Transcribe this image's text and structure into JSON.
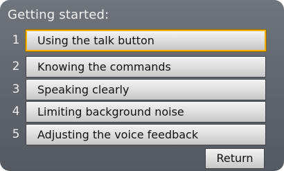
{
  "screen": {
    "title": "Getting started:"
  },
  "menu": {
    "items": [
      {
        "number": "1",
        "label": "Using the talk button",
        "selected": true
      },
      {
        "number": "2",
        "label": "Knowing the commands",
        "selected": false
      },
      {
        "number": "3",
        "label": "Speaking clearly",
        "selected": false
      },
      {
        "number": "4",
        "label": "Limiting background noise",
        "selected": false
      },
      {
        "number": "5",
        "label": "Adjusting the voice feedback",
        "selected": false
      }
    ]
  },
  "controls": {
    "return_label": "Return"
  },
  "colors": {
    "background": "#61666d",
    "selection_border": "#ffb000",
    "button_face": "#dcdcdc"
  }
}
